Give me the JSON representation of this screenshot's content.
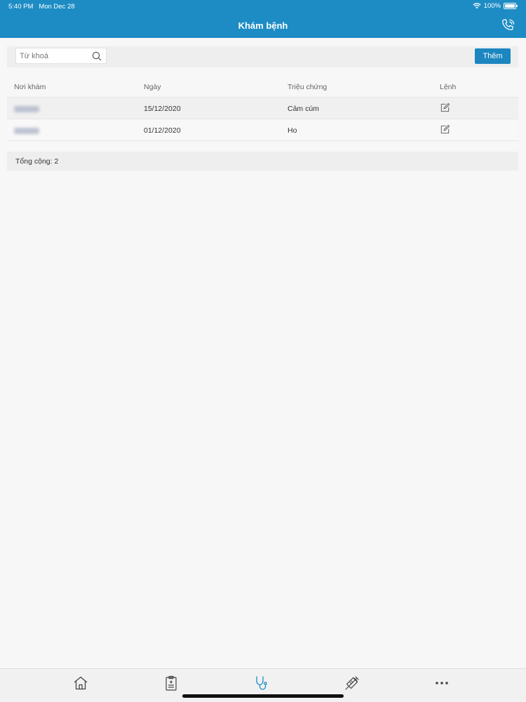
{
  "status_bar": {
    "time": "5:40 PM",
    "date": "Mon Dec 28",
    "battery": "100%"
  },
  "header": {
    "title": "Khám bệnh",
    "call_icon": "phone-call-icon"
  },
  "toolbar": {
    "search_placeholder": "Từ khoá",
    "add_label": "Thêm"
  },
  "table": {
    "columns": [
      "Nơi khám",
      "Ngày",
      "Triệu chứng",
      "Lệnh"
    ],
    "rows": [
      {
        "date": "15/12/2020",
        "symptom": "Cảm cúm",
        "action_icon": "edit-icon"
      },
      {
        "date": "01/12/2020",
        "symptom": "Ho",
        "action_icon": "edit-icon"
      }
    ]
  },
  "footer": {
    "total": "Tổng cộng: 2"
  },
  "tab_bar": {
    "items": [
      "home-icon",
      "clipboard-icon",
      "stethoscope-icon",
      "syringe-icon",
      "more-icon"
    ],
    "active": "stethoscope-icon",
    "active_color": "#1d8cc4"
  },
  "colors": {
    "primary": "#1d8cc4"
  }
}
